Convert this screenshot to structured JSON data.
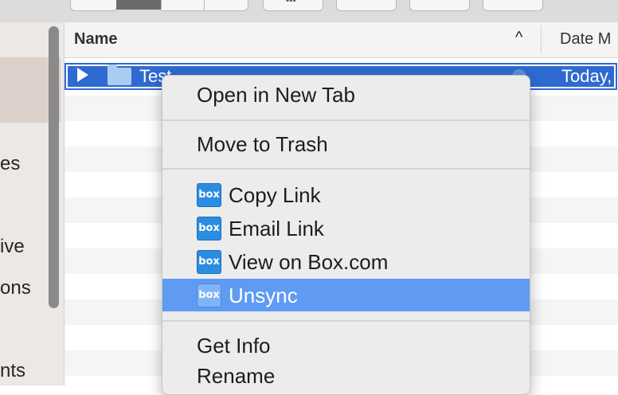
{
  "header": {
    "name_col": "Name",
    "sort_glyph": "^",
    "date_col": "Date M"
  },
  "sidebar": {
    "partial_items": [
      "es",
      "ive",
      "ons",
      "nts"
    ]
  },
  "selected_row": {
    "name": "Test",
    "date": "Today,"
  },
  "context_menu": {
    "open_new_tab": "Open in New Tab",
    "move_to_trash": "Move to Trash",
    "copy_link": "Copy Link",
    "email_link": "Email Link",
    "view_on_box": "View on Box.com",
    "unsync": "Unsync",
    "get_info": "Get Info",
    "rename": "Rename",
    "box_icon_text": "box"
  },
  "colors": {
    "selection": "#2f6ad1",
    "menu_highlight": "#5f9bf3",
    "box_brand": "#2c8ce0"
  }
}
